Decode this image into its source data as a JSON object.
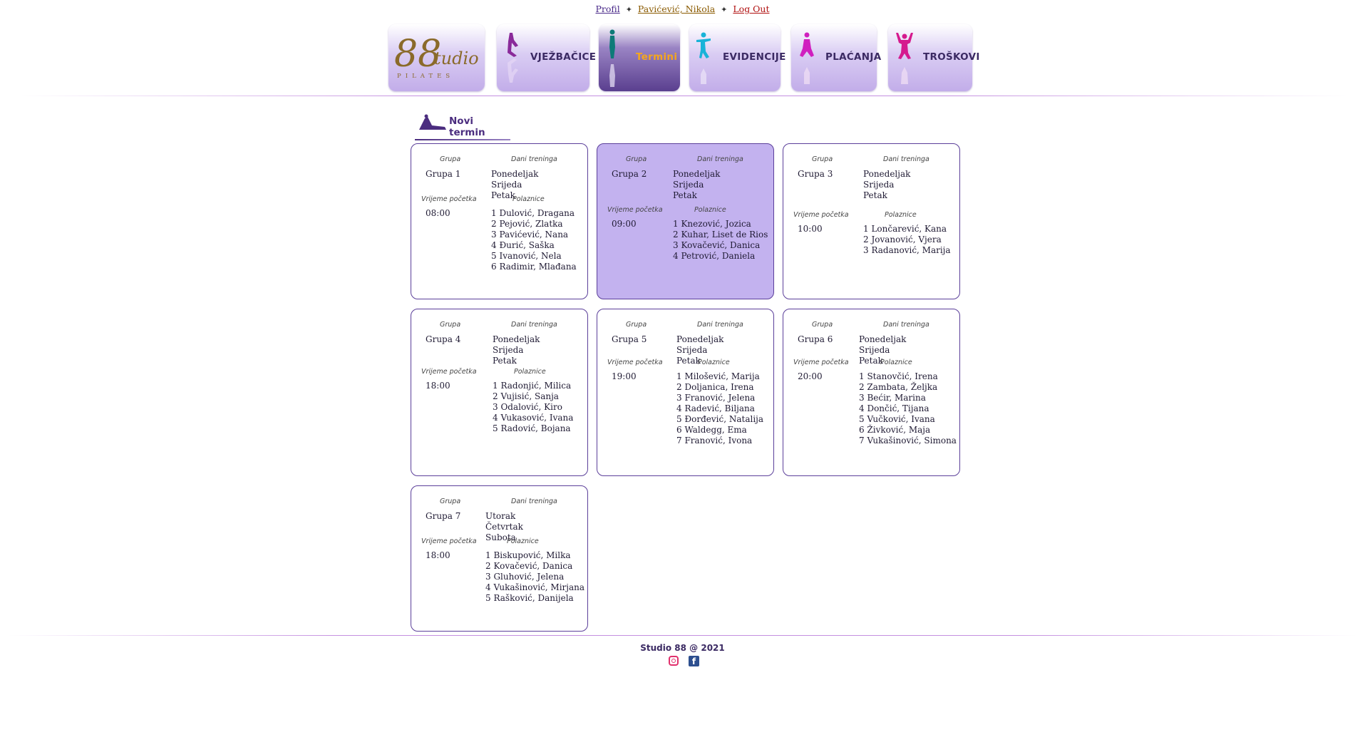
{
  "toplinks": {
    "profil": "Profil",
    "sep": "✦",
    "user": "Pavićević, Nikola",
    "logout": "Log Out"
  },
  "nav": {
    "logo": {
      "num": "88",
      "studio": "tudio",
      "pilates": "PILATES"
    },
    "tabs": [
      {
        "label": "VJEŽBAČICE",
        "color": "#8a2a9a"
      },
      {
        "label": "Termini",
        "color": "#0e7a78",
        "active": true
      },
      {
        "label": "EVIDENCIJE",
        "color": "#19b3d8"
      },
      {
        "label": "PLAĆANJA",
        "color": "#d01fbf"
      },
      {
        "label": "TROŠKOVI",
        "color": "#d51a8e"
      }
    ]
  },
  "new_term": "Novi termin",
  "labels": {
    "grupa": "Grupa",
    "dani": "Dani treninga",
    "vrijeme": "Vrijeme početka",
    "polaznice": "Polaznice"
  },
  "groups": [
    {
      "name": "Grupa 1",
      "days": [
        "Ponedeljak",
        "Srijeda",
        "Petak"
      ],
      "time": "08:00",
      "members": [
        "1 Dulović, Dragana",
        "2 Pejović, Zlatka",
        "3 Pavićević, Nana",
        "4 Đurić, Saška",
        "5 Ivanović, Nela",
        "6 Radimir, Mlađana"
      ]
    },
    {
      "name": "Grupa 2",
      "days": [
        "Ponedeljak",
        "Srijeda",
        "Petak"
      ],
      "time": "09:00",
      "selected": true,
      "members": [
        "1 Knezović, Jozica",
        "2 Kuhar, Liset de Rios",
        "3 Kovačević, Danica",
        "4 Petrović, Daniela"
      ]
    },
    {
      "name": "Grupa 3",
      "days": [
        "Ponedeljak",
        "Srijeda",
        "Petak"
      ],
      "time": "10:00",
      "members": [
        "1 Lončarević, Kana",
        "2 Jovanović, Vjera",
        "3 Radanović, Marija"
      ]
    },
    {
      "name": "Grupa 4",
      "days": [
        "Ponedeljak",
        "Srijeda",
        "Petak"
      ],
      "time": "18:00",
      "members": [
        "1 Radonjić, Milica",
        "2 Vujisić, Sanja",
        "3 Odalović, Kiro",
        "4 Vukasović, Ivana",
        "5 Radović, Bojana"
      ]
    },
    {
      "name": "Grupa 5",
      "days": [
        "Ponedeljak",
        "Srijeda",
        "Petak"
      ],
      "time": "19:00",
      "members": [
        "1 Milošević, Marija",
        "2 Doljanica, Irena",
        "3 Franović, Jelena",
        "4 Radević, Biljana",
        "5 Đorđević, Natalija",
        "6 Waldegg, Ema",
        "7 Franović, Ivona"
      ]
    },
    {
      "name": "Grupa 6",
      "days": [
        "Ponedeljak",
        "Srijeda",
        "Petak"
      ],
      "time": "20:00",
      "members": [
        "1 Stanovčić, Irena",
        "2 Zambata, Željka",
        "3 Bećir, Marina",
        "4 Dončić, Tijana",
        "5 Vučković, Ivana",
        "6 Živković, Maja",
        "7 Vukašinović, Simona"
      ]
    },
    {
      "name": "Grupa 7",
      "days": [
        "Utorak",
        "Četvrtak",
        "Subota"
      ],
      "time": "18:00",
      "members": [
        "1 Biskupović, Milka",
        "2 Kovačević, Danica",
        "3 Gluhović, Jelena",
        "4 Vukašinović, Mirjana",
        "5 Rašković, Danijela"
      ]
    }
  ],
  "footer": {
    "text": "Studio 88 @ 2021",
    "social": [
      "instagram-icon",
      "facebook-icon"
    ]
  }
}
